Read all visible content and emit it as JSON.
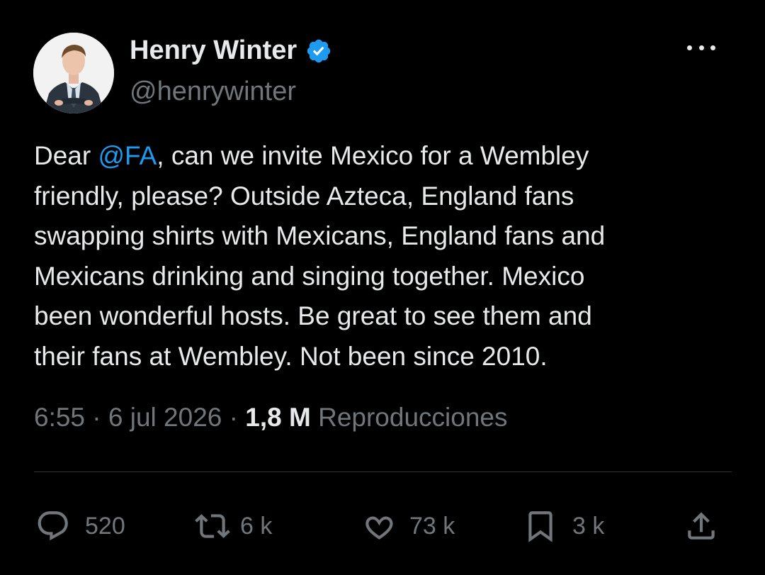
{
  "author": {
    "display_name": "Henry Winter",
    "handle": "@henrywinter",
    "verified": true
  },
  "tweet": {
    "lines": [
      [
        "Dear ",
        "@FA",
        ", can we invite Mexico for a Wembley"
      ],
      "friendly, please? Outside Azteca, England fans",
      "swapping shirts with Mexicans, England fans and",
      "Mexicans drinking and singing together. Mexico",
      "been wonderful hosts. Be great to see them and",
      "their fans at Wembley. Not been since 2010."
    ],
    "line1_prefix": "Dear ",
    "mention": "@FA",
    "line1_suffix": ", can we invite Mexico for a Wembley",
    "line2": "friendly, please? Outside Azteca, England fans",
    "line3": "swapping shirts with Mexicans, England fans and",
    "line4": "Mexicans drinking and singing together. Mexico",
    "line5": "been wonderful hosts. Be great to see them and",
    "line6": "their fans at Wembley. Not been since 2010."
  },
  "meta": {
    "time": "6:55",
    "separator": " · ",
    "date": "6 jul 2026",
    "views_count": "1,8 M",
    "views_label": "Reproducciones"
  },
  "actions": {
    "replies": "520",
    "reposts": "6 k",
    "likes": "73 k",
    "bookmarks": "3 k"
  },
  "colors": {
    "background": "#000000",
    "text": "#e7e9ea",
    "secondary": "#71767b",
    "accent": "#1d9bf0"
  },
  "icons": [
    "verified-badge-icon",
    "more-icon",
    "reply-icon",
    "repost-icon",
    "like-icon",
    "bookmark-icon",
    "share-icon"
  ]
}
